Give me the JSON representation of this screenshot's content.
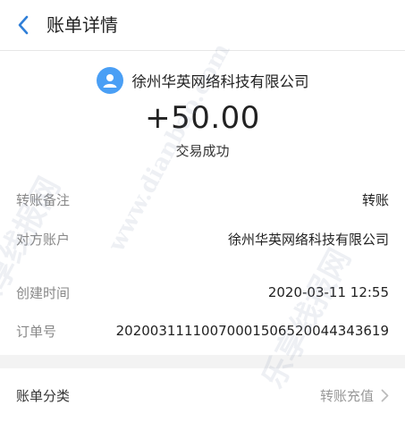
{
  "header": {
    "title": "账单详情"
  },
  "merchant": {
    "name": "徐州华英网络科技有限公司"
  },
  "transaction": {
    "amount": "+50.00",
    "status": "交易成功"
  },
  "details": [
    {
      "label": "转账备注",
      "value": "转账"
    },
    {
      "label": "对方账户",
      "value": "徐州华英网络科技有限公司"
    },
    {
      "label": "创建时间",
      "value": "2020-03-11 12:55"
    },
    {
      "label": "订单号",
      "value": "20200311110070001506520044343619"
    }
  ],
  "category": {
    "label": "账单分类",
    "value": "转账充值"
  },
  "watermark": {
    "text_cn": "乐享线报网",
    "text_url": "www.dianbao.com"
  },
  "colors": {
    "accent": "#2f7fd8",
    "avatar": "#4a9ff5",
    "background": "#f3f3f3"
  },
  "icons": {
    "back": "chevron-left-icon",
    "avatar": "user-icon",
    "arrow": "chevron-right-icon"
  }
}
